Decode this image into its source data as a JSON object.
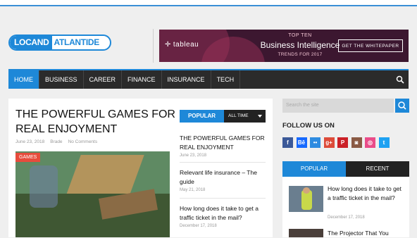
{
  "logo": {
    "part1": "LOCAND",
    "part2": "ATLANTIDE"
  },
  "banner": {
    "brand": "tableau",
    "top": "TOP TEN",
    "headline": "Business Intelligence",
    "sub": "TRENDS FOR 2017",
    "cta": "GET THE WHITEPAPER"
  },
  "nav": {
    "items": [
      "HOME",
      "BUSINESS",
      "CAREER",
      "FINANCE",
      "INSURANCE",
      "TECH"
    ],
    "active_color": "#1e88d8"
  },
  "article": {
    "title": "THE POWERFUL GAMES FOR REAL ENJOYMENT",
    "date": "June 23, 2018",
    "author": "Brade",
    "comments": "No Comments",
    "category": "GAMES"
  },
  "popular": {
    "tab": "POPULAR",
    "filter": "ALL TIME",
    "items": [
      {
        "title": "THE POWERFUL GAMES FOR REAL ENJOYMENT",
        "date": "June 23, 2018"
      },
      {
        "title": "Relevant life insurance – The guide",
        "date": "May 21, 2018"
      },
      {
        "title": "How long does it take to get a traffic ticket in the mail?",
        "date": "December 17, 2018"
      }
    ]
  },
  "sidebar": {
    "search_placeholder": "Search the site",
    "follow_title": "FOLLOW US ON",
    "socials": [
      {
        "name": "facebook",
        "glyph": "f",
        "color": "#3b5998"
      },
      {
        "name": "behance",
        "glyph": "Bē",
        "color": "#1769ff"
      },
      {
        "name": "flickr",
        "glyph": "••",
        "color": "#2e8be0"
      },
      {
        "name": "google-plus",
        "glyph": "g+",
        "color": "#dd4b39"
      },
      {
        "name": "pinterest",
        "glyph": "P",
        "color": "#cb2027"
      },
      {
        "name": "instagram",
        "glyph": "◙",
        "color": "#8a5a44"
      },
      {
        "name": "dribbble",
        "glyph": "◎",
        "color": "#ea4c89"
      },
      {
        "name": "twitter",
        "glyph": "t",
        "color": "#1da1f2"
      }
    ],
    "tabs": [
      "POPULAR",
      "RECENT"
    ],
    "posts": [
      {
        "title": "How long does it take to get a traffic ticket in the mail?",
        "date": "December 17, 2018"
      },
      {
        "title": "The Projector That You"
      }
    ]
  }
}
